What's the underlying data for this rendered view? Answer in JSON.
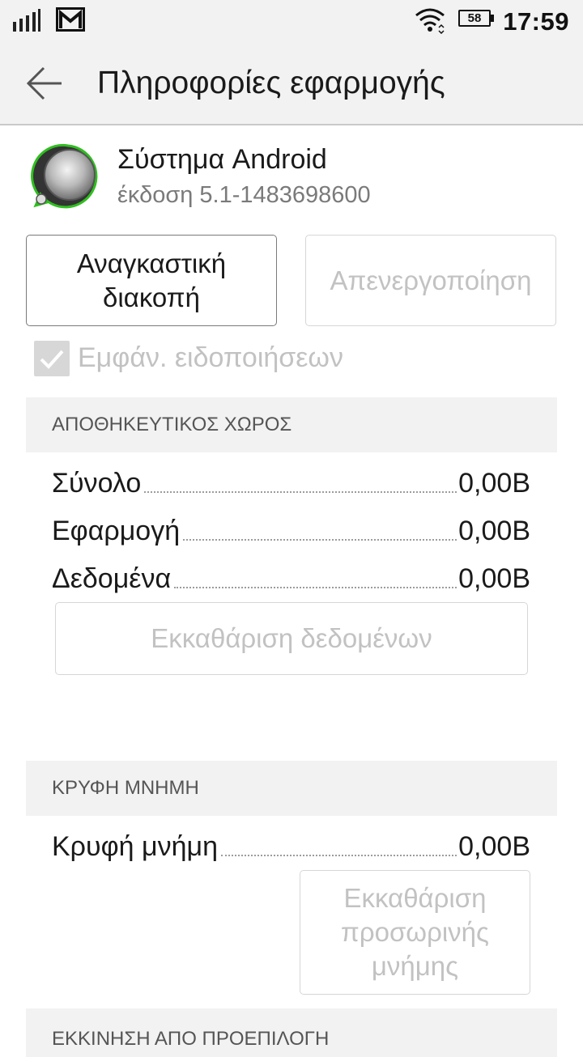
{
  "status_bar": {
    "time": "17:59",
    "battery": "58",
    "icons": [
      "signal-icon",
      "gmail-icon",
      "wifi-icon",
      "battery-icon"
    ]
  },
  "action_bar": {
    "title": "Πληροφορίες εφαρμογής",
    "back_icon": "back-arrow-icon"
  },
  "app": {
    "name": "Σύστημα Android",
    "version": "έκδοση 5.1-1483698600",
    "icon": "android-system-icon"
  },
  "buttons": {
    "force_stop": "Αναγκαστική διακοπή",
    "disable": "Απενεργοποίηση"
  },
  "notifications": {
    "label": "Εμφάν. ειδοποιήσεων",
    "checked": true
  },
  "storage": {
    "header": "ΑΠΟΘΗΚΕΥΤΙΚΟΣ ΧΩΡΟΣ",
    "rows": [
      {
        "label": "Σύνολο",
        "value": "0,00B"
      },
      {
        "label": "Εφαρμογή",
        "value": "0,00B"
      },
      {
        "label": "Δεδομένα",
        "value": "0,00B"
      }
    ],
    "clear_data": "Εκκαθάριση δεδομένων"
  },
  "cache": {
    "header": "ΚΡΥΦΗ ΜΝΗΜΗ",
    "row": {
      "label": "Κρυφή μνήμη",
      "value": "0,00B"
    },
    "clear_cache": "Εκκαθάριση προσωρινής μνήμης"
  },
  "launch": {
    "header": "ΕΚΚΙΝΗΣΗ ΑΠΟ ΠΡΟΕΠΙΛΟΓΗ"
  },
  "colors": {
    "accent_green": "#2fbf1f",
    "disabled_text": "#c2c2c2",
    "section_bg": "#f2f2f2"
  }
}
